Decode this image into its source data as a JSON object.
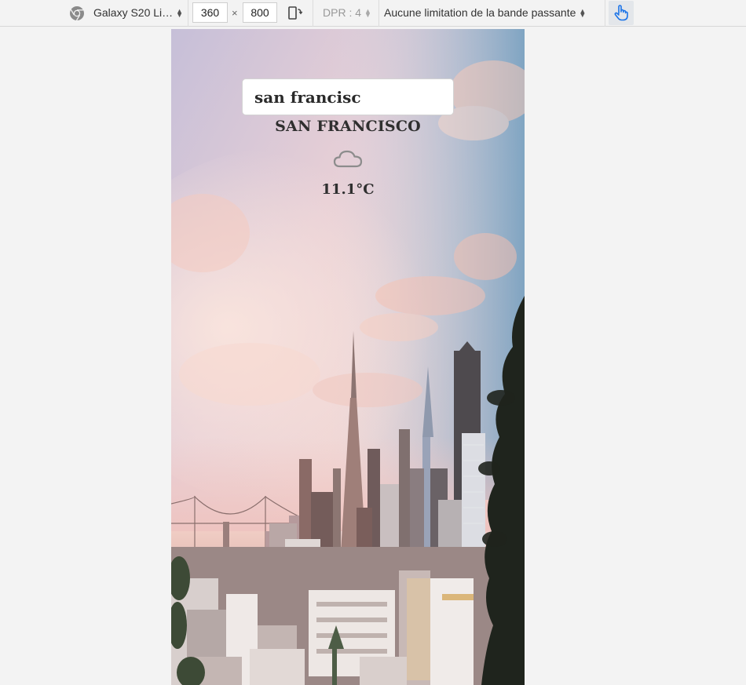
{
  "devtools": {
    "device_name": "Galaxy S20 Li…",
    "width_value": "360",
    "height_value": "800",
    "times_symbol": "×",
    "dpr_label": "DPR : 4",
    "throttling_label": "Aucune limitation de la bande passante",
    "icons": {
      "device": "chrome-device-icon",
      "rotate": "rotate-device-icon",
      "touch": "touch-simulation-icon"
    },
    "accent_color": "#1a73e8"
  },
  "app": {
    "search_value": "san francisc",
    "city_name": "SAN FRANCISCO",
    "weather_icon": "cloud-icon",
    "temperature": "11.1°C",
    "background": "san-francisco-skyline-sunset"
  }
}
